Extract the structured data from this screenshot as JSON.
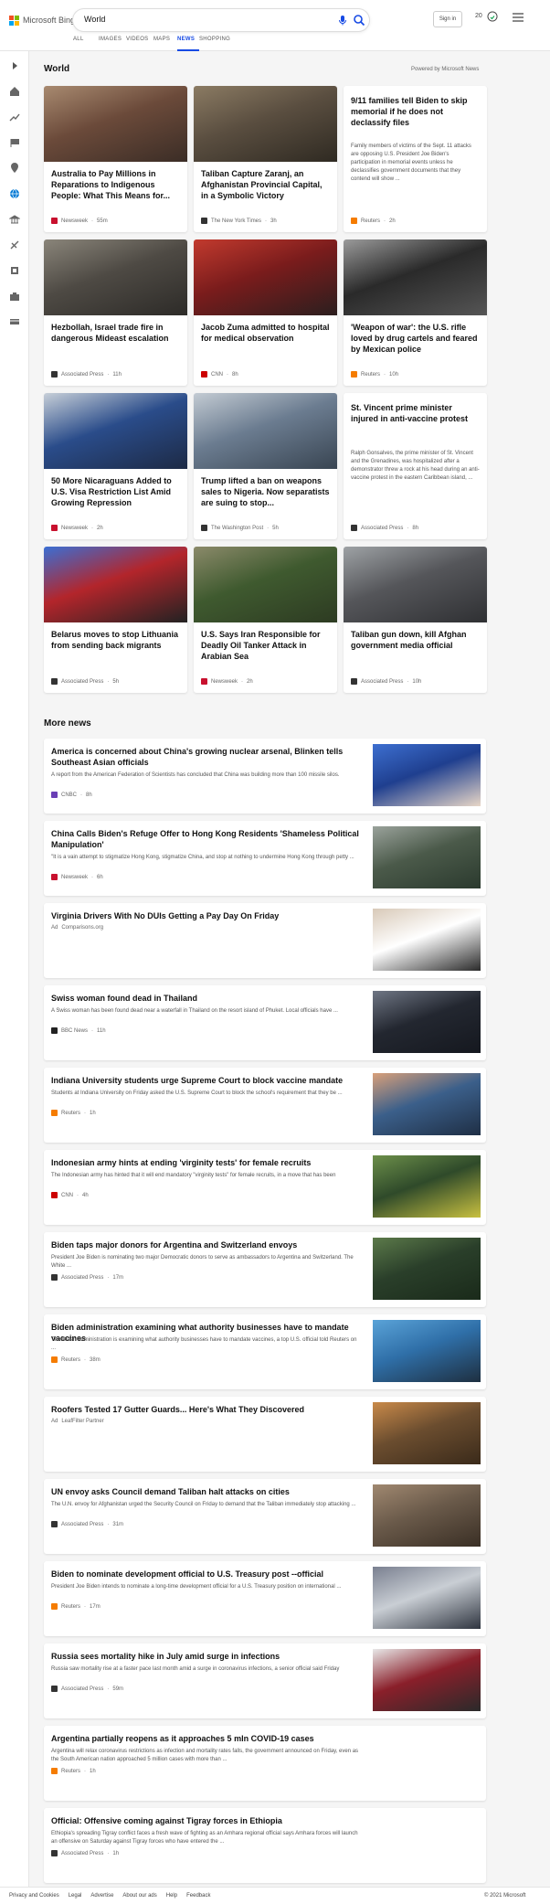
{
  "brand": {
    "name": "Microsoft Bing"
  },
  "search": {
    "query": "World"
  },
  "header": {
    "signin": "Sign in",
    "rewards": "20"
  },
  "tabs": [
    "ALL",
    "IMAGES",
    "VIDEOS",
    "MAPS",
    "NEWS",
    "SHOPPING"
  ],
  "active_tab": "NEWS",
  "section": {
    "title": "World",
    "powered": "Powered by Microsoft News"
  },
  "cards": [
    {
      "title": "Australia to Pay Millions in Reparations to Indigenous People: What This Means for...",
      "source": "Newsweek",
      "time": "55m",
      "color": "#c8102e",
      "img": "protest"
    },
    {
      "title": "Taliban Capture Zaranj, an Afghanistan Provincial Capital, in a Symbolic Victory",
      "source": "The New York Times",
      "time": "3h",
      "color": "#333333",
      "img": "taliban"
    },
    {
      "title": "9/11 families tell Biden to skip memorial if he does not declassify files",
      "snippet": "Family members of victims of the Sept. 11 attacks are opposing U.S. President Joe Biden's participation in memorial events unless he declassifies government documents that they contend will show ...",
      "source": "Reuters",
      "time": "2h",
      "color": "#f57c00",
      "img": "none"
    },
    {
      "title": "Hezbollah, Israel trade fire in dangerous Mideast escalation",
      "source": "Associated Press",
      "time": "11h",
      "color": "#333333",
      "img": "smoke"
    },
    {
      "title": "Jacob Zuma admitted to hospital for medical observation",
      "source": "CNN",
      "time": "8h",
      "color": "#cc0000",
      "img": "zuma"
    },
    {
      "title": "'Weapon of war': the U.S. rifle loved by drug cartels and feared by Mexican police",
      "source": "Reuters",
      "time": "10h",
      "color": "#f57c00",
      "img": "rifles"
    },
    {
      "title": "50 More Nicaraguans Added to U.S. Visa Restriction List Amid Growing Repression",
      "source": "Newsweek",
      "time": "2h",
      "color": "#c8102e",
      "img": "nicaragua"
    },
    {
      "title": "Trump lifted a ban on weapons sales to Nigeria. Now separatists are suing to stop...",
      "source": "The Washington Post",
      "time": "5h",
      "color": "#333333",
      "img": "jet"
    },
    {
      "title": "St. Vincent prime minister injured in anti-vaccine protest",
      "snippet": "Ralph Gonsalves, the prime minister of St. Vincent and the Grenadines, was hospitalized after a demonstrator threw a rock at his head during an anti-vaccine protest in the eastern Caribbean island, ...",
      "source": "Associated Press",
      "time": "8h",
      "color": "#333333",
      "img": "none"
    },
    {
      "title": "Belarus moves to stop Lithuania from sending back migrants",
      "source": "Associated Press",
      "time": "5h",
      "color": "#333333",
      "img": "belarus"
    },
    {
      "title": "U.S. Says Iran Responsible for Deadly Oil Tanker Attack in Arabian Sea",
      "source": "Newsweek",
      "time": "2h",
      "color": "#c8102e",
      "img": "crowd"
    },
    {
      "title": "Taliban gun down, kill Afghan government media official",
      "source": "Associated Press",
      "time": "10h",
      "color": "#333333",
      "img": "street"
    }
  ],
  "more_title": "More news",
  "rows": [
    {
      "title": "America is concerned about China's growing nuclear arsenal, Blinken tells Southeast Asian officials",
      "snippet": "A report from the American Federation of Scientists has concluded that China was building more than 100 missile silos.",
      "source": "CNBC",
      "time": "8h",
      "color": "#6a3fb5",
      "img": "blinken"
    },
    {
      "title": "China Calls Biden's Refuge Offer to Hong Kong Residents 'Shameless Political Manipulation'",
      "snippet": "\"It is a vain attempt to stigmatize Hong Kong, stigmatize China, and stop at nothing to undermine Hong Kong through petty ...",
      "source": "Newsweek",
      "time": "6h",
      "color": "#c8102e",
      "img": "hk"
    },
    {
      "title": "Virginia Drivers With No DUIs Getting a Pay Day On Friday",
      "snippet": "",
      "source": "Comparisons.org",
      "time": "",
      "ad": "Ad",
      "color": "#999999",
      "img": "man"
    },
    {
      "title": "Swiss woman found dead in Thailand",
      "snippet": "A Swiss woman has been found dead near a waterfall in Thailand on the resort island of Phuket. Local officials have ...",
      "source": "BBC News",
      "time": "11h",
      "color": "#222222",
      "img": "sea"
    },
    {
      "title": "Indiana University students urge Supreme Court to block vaccine mandate",
      "snippet": "Students at Indiana University on Friday asked the U.S. Supreme Court to block the school's requirement that they be ...",
      "source": "Reuters",
      "time": "1h",
      "color": "#f57c00",
      "img": "vaccine"
    },
    {
      "title": "Indonesian army hints at ending 'virginity tests' for female recruits",
      "snippet": "The Indonesian army has hinted that it will end mandatory \"virginity tests\" for female recruits, in a move that has been",
      "source": "CNN",
      "time": "4h",
      "color": "#cc0000",
      "img": "army"
    },
    {
      "title": "Biden taps major donors for Argentina and Switzerland envoys",
      "snippet": "President Joe Biden is nominating two major Democratic donors to serve as ambassadors to Argentina and Switzerland. The White ...",
      "source": "Associated Press",
      "time": "17m",
      "color": "#333333",
      "img": "biden"
    },
    {
      "title": "Biden administration examining what authority businesses have to mandate vaccines",
      "snippet": "The Biden administration is examining what authority businesses have to mandate vaccines, a top U.S. official told Reuters on ...",
      "source": "Reuters",
      "time": "38m",
      "color": "#f57c00",
      "img": "mask"
    },
    {
      "title": "Roofers Tested 17 Gutter Guards... Here's What They Discovered",
      "snippet": "",
      "source": "LeafFilter Partner",
      "time": "",
      "ad": "Ad",
      "color": "#999999",
      "img": "roof"
    },
    {
      "title": "UN envoy asks Council demand Taliban halt attacks on cities",
      "snippet": "The U.N. envoy for Afghanistan urged the Security Council on Friday to demand that the Taliban immediately stop attacking ...",
      "source": "Associated Press",
      "time": "31m",
      "color": "#333333",
      "img": "camp"
    },
    {
      "title": "Biden to nominate development official to U.S. Treasury post --official",
      "snippet": "President Joe Biden intends to nominate a long-time development official for a U.S. Treasury position on international ...",
      "source": "Reuters",
      "time": "17m",
      "color": "#f57c00",
      "img": "treasury"
    },
    {
      "title": "Russia sees mortality hike in July amid surge in infections",
      "snippet": "Russia saw mortality rise at a faster pace last month amid a surge in coronavirus infections, a senior official said Friday",
      "source": "Associated Press",
      "time": "59m",
      "color": "#333333",
      "img": "covid"
    },
    {
      "title": "Argentina partially reopens as it approaches 5 mln COVID-19 cases",
      "snippet": "Argentina will relax coronavirus restrictions as infection and mortality rates falls, the government announced on Friday, even as the South American nation approached 5 million cases with more than ...",
      "source": "Reuters",
      "time": "1h",
      "color": "#f57c00",
      "img": "none"
    },
    {
      "title": "Official: Offensive coming against Tigray forces in Ethiopia",
      "snippet": "Ethiopia's spreading Tigray conflict faces a fresh wave of fighting as an Amhara regional official says Amhara forces will launch an offensive on Saturday against Tigray forces who have entered the ...",
      "source": "Associated Press",
      "time": "1h",
      "color": "#333333",
      "img": "none"
    }
  ],
  "footer": {
    "links": [
      "Privacy and Cookies",
      "Legal",
      "Advertise",
      "About our ads",
      "Help",
      "Feedback"
    ],
    "copyright": "© 2021 Microsoft"
  }
}
